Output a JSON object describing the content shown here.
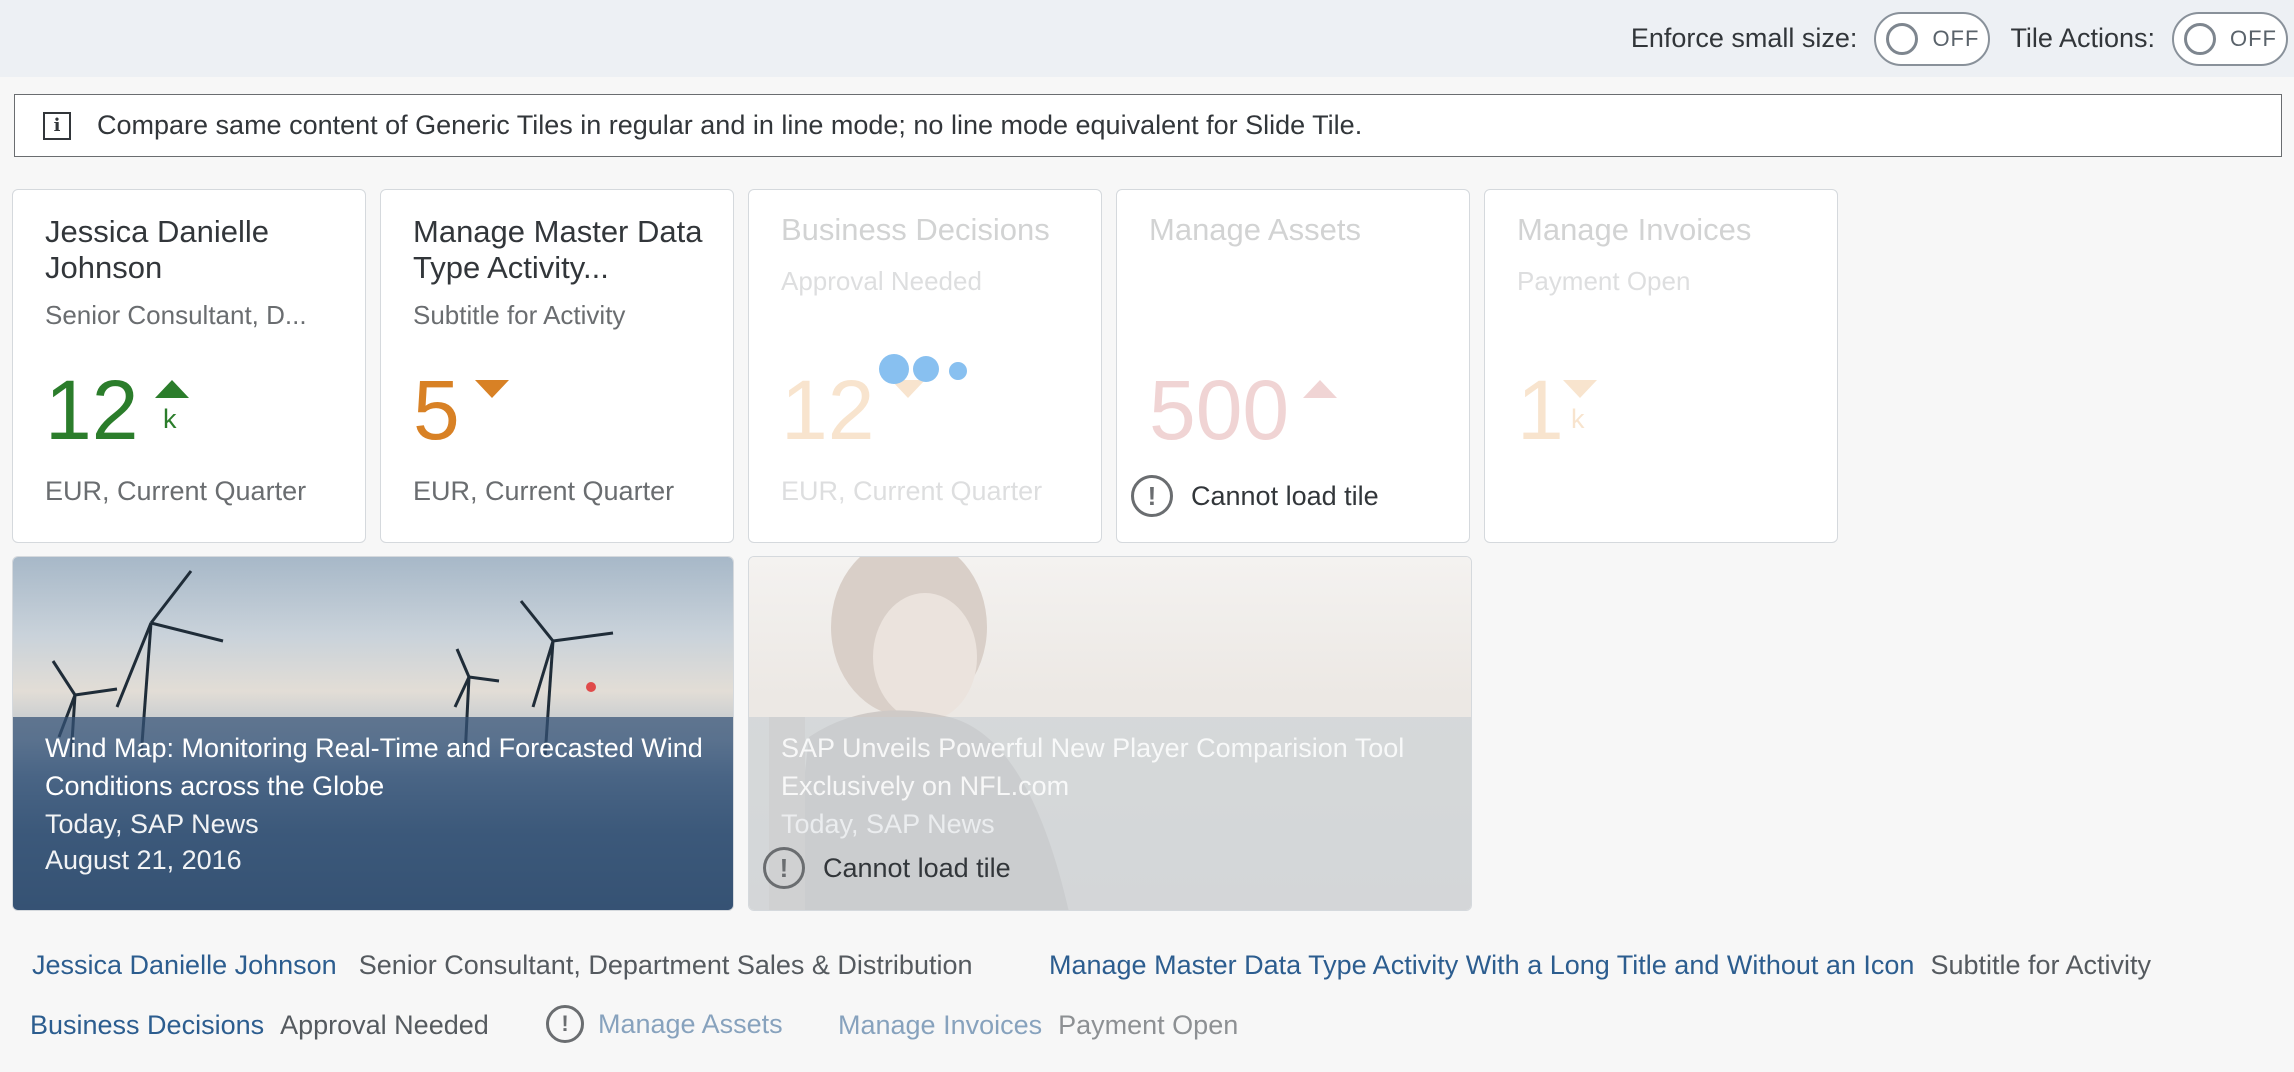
{
  "toolbar": {
    "enforce_label": "Enforce small size:",
    "enforce_state": "OFF",
    "tile_actions_label": "Tile Actions:",
    "tile_actions_state": "OFF"
  },
  "info_strip": {
    "icon": "info-icon",
    "text": "Compare same content of Generic Tiles in regular and in line mode; no line mode equivalent for Slide Tile."
  },
  "tiles": [
    {
      "title": "Jessica Danielle Johnson",
      "subtitle": "Senior Consultant, D...",
      "value": "12",
      "scale": "k",
      "indicator": "up",
      "value_color": "#2b7d2b",
      "footer": "EUR, Current Quarter"
    },
    {
      "title": "Manage Master Data Type Activity...",
      "subtitle": "Subtitle for Activity",
      "value": "5",
      "indicator": "down",
      "value_color": "#d88125",
      "footer": "EUR, Current Quarter"
    },
    {
      "title": "Business Decisions",
      "subtitle": "Approval Needed",
      "value": "12",
      "indicator": "down",
      "value_color": "#e9a158",
      "footer": "EUR, Current Quarter",
      "state": "loading"
    },
    {
      "title": "Manage Assets",
      "value": "500",
      "indicator": "up",
      "value_color": "#c04040",
      "error_text": "Cannot load tile",
      "state": "failed"
    },
    {
      "title": "Manage Invoices",
      "subtitle": "Payment Open",
      "value": "1",
      "scale": "k",
      "indicator": "down",
      "value_color": "#e9a158",
      "state": "disabled"
    }
  ],
  "slide_tiles": [
    {
      "title": "Wind Map: Monitoring Real-Time and Forecasted Wind Conditions across the Globe",
      "subtitle": "Today, SAP News",
      "date": "August 21, 2016"
    },
    {
      "title": "SAP Unveils Powerful New Player Comparision Tool Exclusively on NFL.com",
      "subtitle": "Today, SAP News",
      "error_text": "Cannot load tile",
      "state": "failed"
    }
  ],
  "line_mode": {
    "row1": [
      {
        "title": "Jessica Danielle Johnson",
        "subtitle": "Senior Consultant, Department Sales & Distribution"
      },
      {
        "title": "Manage Master Data Type Activity With a Long Title and Without an Icon",
        "subtitle": "Subtitle for Activity"
      }
    ],
    "row2": [
      {
        "title": "Business Decisions",
        "subtitle": "Approval Needed"
      },
      {
        "title": "Manage Assets",
        "icon": "error-icon",
        "state": "failed"
      },
      {
        "title": "Manage Invoices",
        "subtitle": "Payment Open",
        "state": "disabled"
      }
    ]
  }
}
